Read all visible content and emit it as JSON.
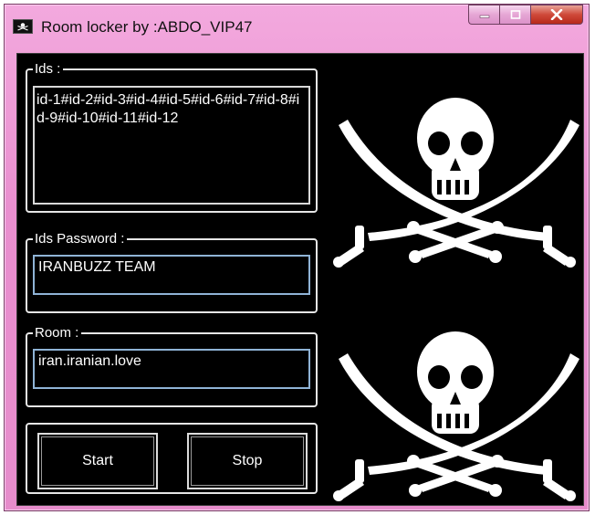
{
  "window": {
    "title": "Room locker by :ABDO_VIP47",
    "controls": {
      "minimize": "minimize",
      "maximize": "maximize",
      "close": "close"
    }
  },
  "groups": {
    "ids": {
      "label": "Ids :",
      "value": "id-1#id-2#id-3#id-4#id-5#id-6#id-7#id-8#id-9#id-10#id-11#id-12"
    },
    "password": {
      "label": "Ids Password :",
      "value": "IRANBUZZ TEAM"
    },
    "room": {
      "label": "Room :",
      "value": "iran.iranian.love"
    }
  },
  "buttons": {
    "start": "Start",
    "stop": "Stop"
  },
  "icons": [
    "pirate-flag-icon",
    "minimize-icon",
    "maximize-icon",
    "close-icon",
    "jolly-roger-icon"
  ],
  "colors": {
    "frame": "#e98fcf",
    "client_bg": "#000000",
    "text": "#ffffff",
    "close_button": "#cf4a3a"
  }
}
